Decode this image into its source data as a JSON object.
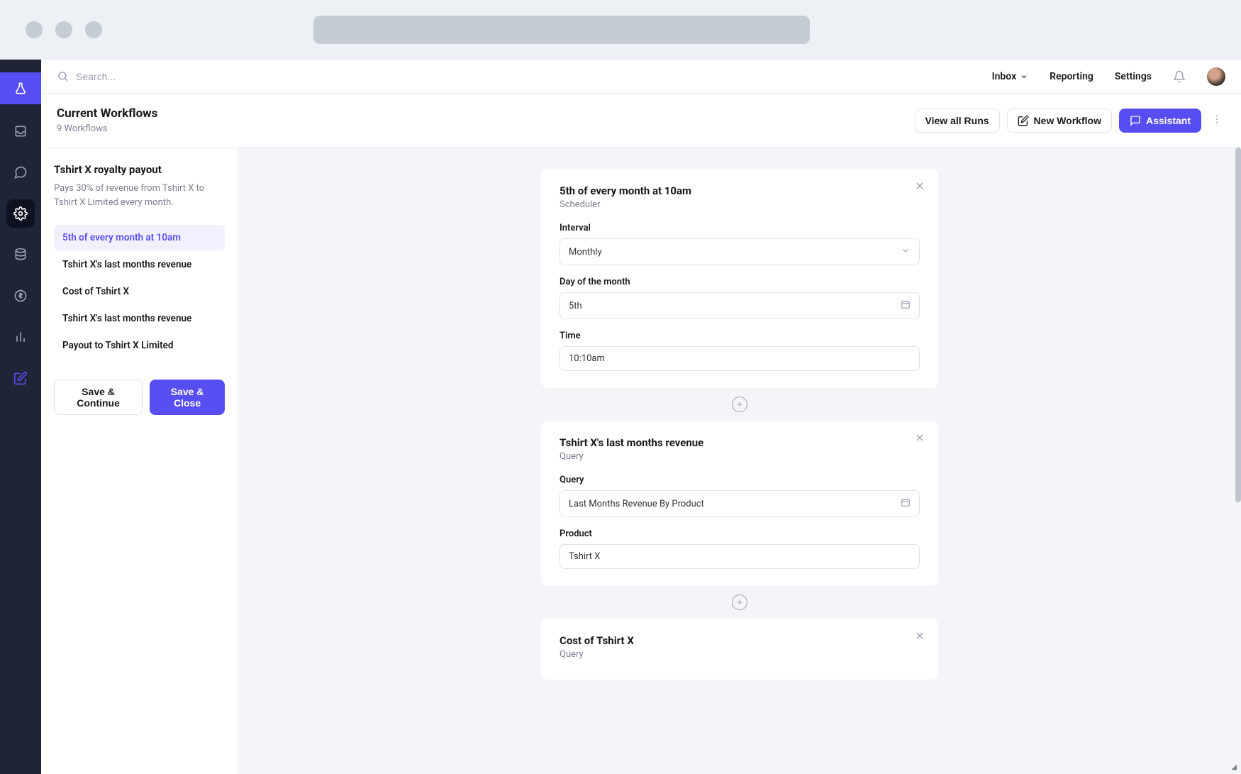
{
  "topbar": {
    "search_placeholder": "Search...",
    "inbox": "Inbox",
    "reporting": "Reporting",
    "settings": "Settings"
  },
  "page": {
    "title": "Current Workflows",
    "subtitle": "9 Workflows",
    "view_all_runs": "View all Runs",
    "new_workflow": "New Workflow",
    "assistant": "Assistant"
  },
  "workflow": {
    "title": "Tshirt X royalty payout",
    "description": "Pays 30% of revenue from Tshirt X to Tshirt X Limited every month.",
    "save_continue": "Save & Continue",
    "save_close": "Save & Close",
    "steps": [
      "5th of every month at 10am",
      "Tshirt X's last months revenue",
      "Cost of Tshirt X",
      "Tshirt X's last months revenue",
      "Payout to Tshirt X Limited"
    ]
  },
  "cards": {
    "scheduler": {
      "title": "5th of every month at 10am",
      "subtitle": "Scheduler",
      "interval_label": "Interval",
      "interval_value": "Monthly",
      "day_label": "Day of the month",
      "day_value": "5th",
      "time_label": "Time",
      "time_value": "10:10am"
    },
    "revenue": {
      "title": "Tshirt X's last months revenue",
      "subtitle": "Query",
      "query_label": "Query",
      "query_value": "Last Months Revenue By Product",
      "product_label": "Product",
      "product_value": "Tshirt X"
    },
    "cost": {
      "title": "Cost of Tshirt X",
      "subtitle": "Query"
    }
  }
}
